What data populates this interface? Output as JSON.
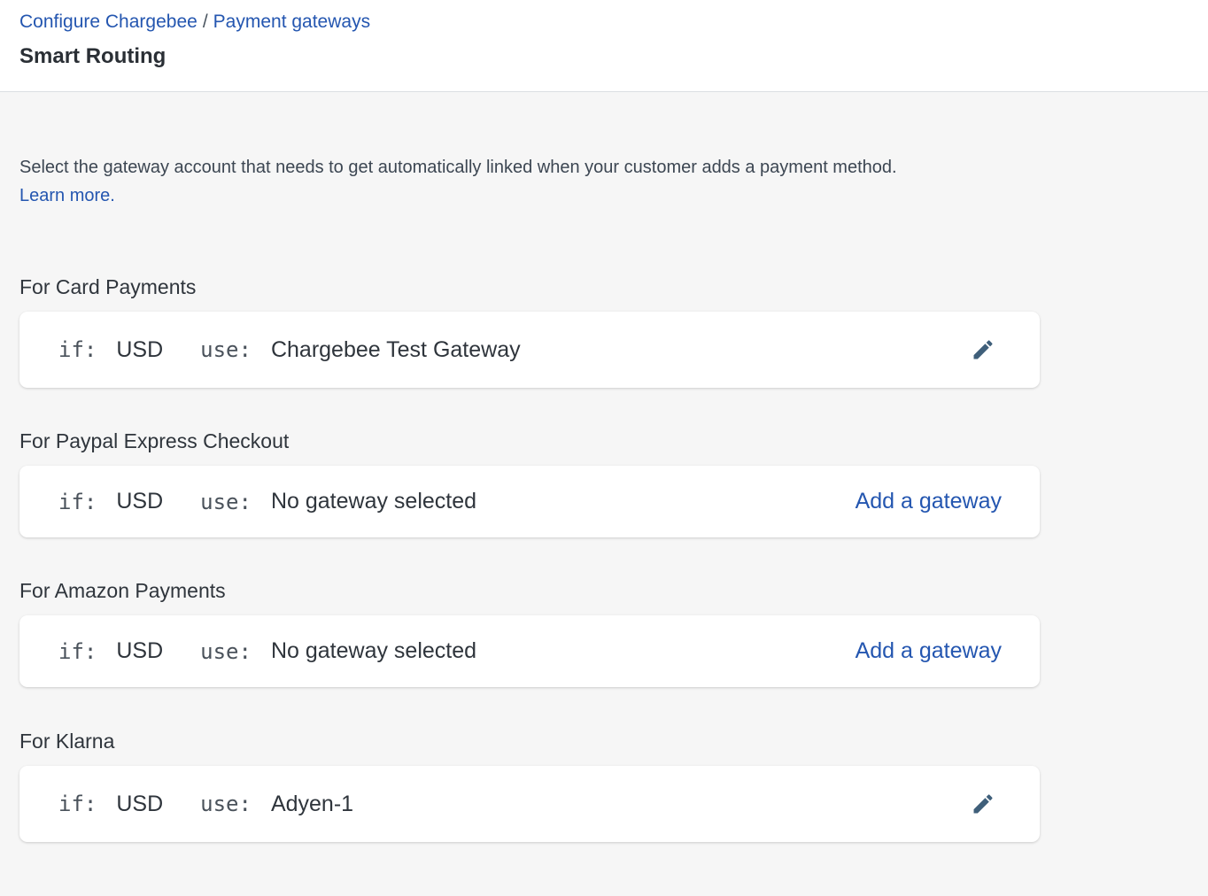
{
  "breadcrumb": {
    "root": "Configure Chargebee",
    "separator": "/",
    "current": "Payment gateways"
  },
  "page": {
    "title": "Smart Routing"
  },
  "intro": {
    "text": "Select the gateway account that needs to get automatically linked when your customer adds a payment method.",
    "learn_more": "Learn more."
  },
  "sections": [
    {
      "title": "For Card Payments",
      "if_label": "if:",
      "currency": "USD",
      "use_label": "use:",
      "gateway": "Chargebee Test Gateway",
      "action": "edit",
      "icon": "pencil-icon"
    },
    {
      "title": "For Paypal Express Checkout",
      "if_label": "if:",
      "currency": "USD",
      "use_label": "use:",
      "gateway": "No gateway selected",
      "action": "Add a gateway"
    },
    {
      "title": "For Amazon Payments",
      "if_label": "if:",
      "currency": "USD",
      "use_label": "use:",
      "gateway": "No gateway selected",
      "action": "Add a gateway"
    },
    {
      "title": "For Klarna",
      "if_label": "if:",
      "currency": "USD",
      "use_label": "use:",
      "gateway": "Adyen-1",
      "action": "edit",
      "icon": "pencil-icon"
    }
  ],
  "colors": {
    "link": "#2456b0",
    "icon": "#3f5f7a",
    "background": "#f6f6f6"
  }
}
